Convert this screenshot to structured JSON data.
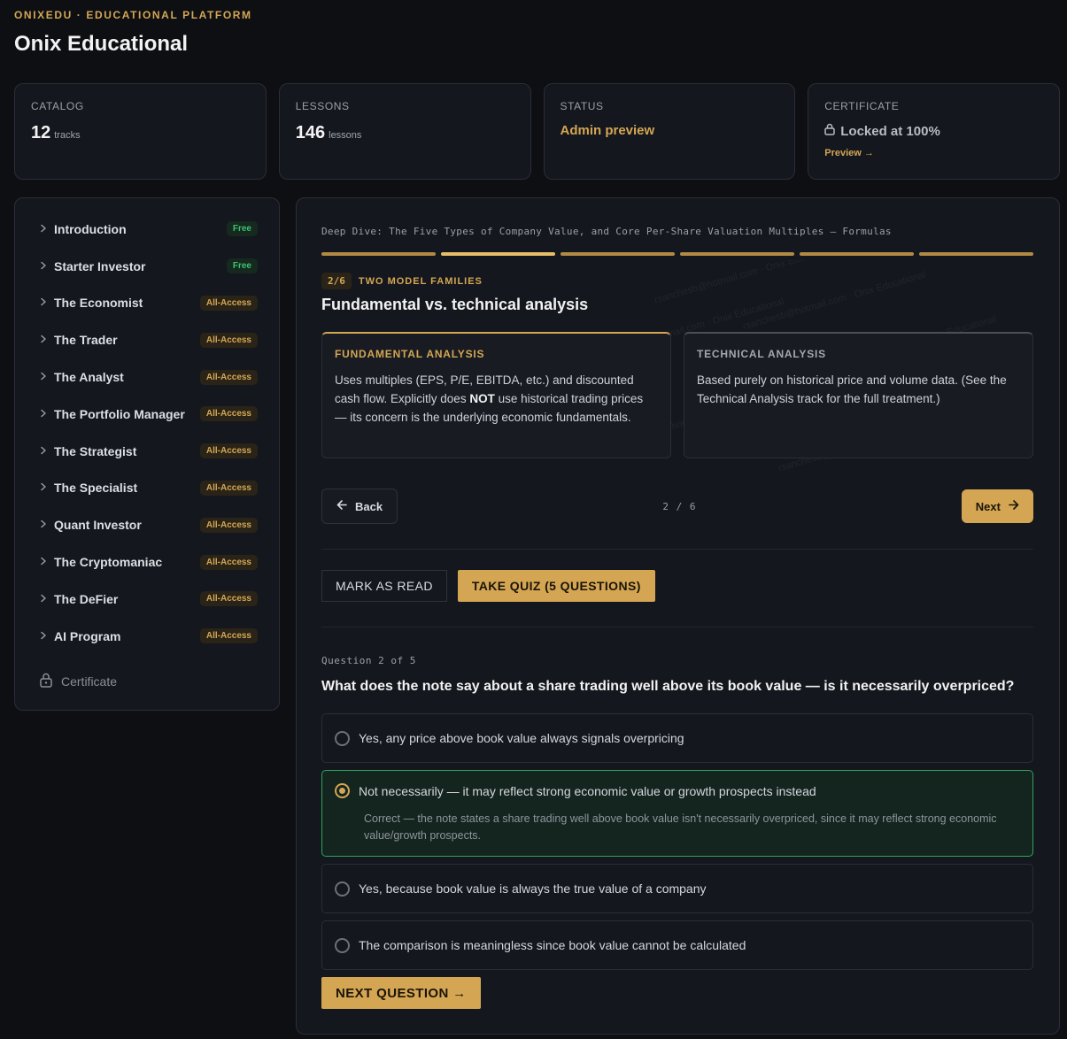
{
  "brand": {
    "kicker": "ONIXEDU · EDUCATIONAL PLATFORM",
    "title": "Onix Educational"
  },
  "stats": {
    "catalog": {
      "label": "CATALOG",
      "value": "12",
      "unit": "tracks"
    },
    "lessons": {
      "label": "LESSONS",
      "value": "146",
      "unit": "lessons"
    },
    "status": {
      "label": "STATUS",
      "value": "Admin preview"
    },
    "certificate": {
      "label": "CERTIFICATE",
      "value": "Locked at 100%",
      "link": "Preview →"
    }
  },
  "sidebar": {
    "items": [
      {
        "label": "Introduction",
        "badge": "Free"
      },
      {
        "label": "Starter Investor",
        "badge": "Free"
      },
      {
        "label": "The Economist",
        "badge": "All-Access"
      },
      {
        "label": "The Trader",
        "badge": "All-Access"
      },
      {
        "label": "The Analyst",
        "badge": "All-Access"
      },
      {
        "label": "The Portfolio Manager",
        "badge": "All-Access"
      },
      {
        "label": "The Strategist",
        "badge": "All-Access"
      },
      {
        "label": "The Specialist",
        "badge": "All-Access"
      },
      {
        "label": "Quant Investor",
        "badge": "All-Access"
      },
      {
        "label": "The Cryptomaniac",
        "badge": "All-Access"
      },
      {
        "label": "The DeFier",
        "badge": "All-Access"
      },
      {
        "label": "AI Program",
        "badge": "All-Access"
      }
    ],
    "certificate_label": "Certificate"
  },
  "lesson": {
    "title": "Deep Dive: The Five Types of Company Value, and Core Per-Share Valuation Multiples — Formulas",
    "total_slides": 6,
    "current_slide": 2,
    "step_chip": "2/6",
    "step_kicker": "TWO MODEL FAMILIES",
    "slide_title": "Fundamental vs. technical analysis",
    "watermark": "rsanchesb@hotmail.com · Onix Educational",
    "cards": {
      "fundamental": {
        "kicker": "FUNDAMENTAL ANALYSIS",
        "body_pre": "Uses multiples (EPS, P/E, EBITDA, etc.) and discounted cash flow. Explicitly does ",
        "body_bold": "NOT",
        "body_post": " use historical trading prices — its concern is the underlying economic fundamentals."
      },
      "technical": {
        "kicker": "TECHNICAL ANALYSIS",
        "body": "Based purely on historical price and volume data. (See the Technical Analysis track for the full treatment.)"
      }
    },
    "back_label": "Back",
    "page_indicator": "2 / 6",
    "next_label": "Next",
    "mark_read_label": "MARK AS READ",
    "take_quiz_label": "TAKE QUIZ (5 QUESTIONS)"
  },
  "quiz": {
    "counter": "Question 2 of 5",
    "question": "What does the note say about a share trading well above its book value — is it necessarily overpriced?",
    "options": [
      {
        "label": "Yes, any price above book value always signals overpricing"
      },
      {
        "label": "Not necessarily — it may reflect strong economic value or growth prospects instead",
        "feedback": "Correct — the note states a share trading well above book value isn't necessarily overpriced, since it may reflect strong economic value/growth prospects."
      },
      {
        "label": "Yes, because book value is always the true value of a company"
      },
      {
        "label": "The comparison is meaningless since book value cannot be calculated"
      }
    ],
    "selected_index": 1,
    "next_question_label": "NEXT QUESTION →"
  },
  "colors": {
    "accent": "#d4a654",
    "success": "#2fa35f",
    "background": "#0d0f13",
    "surface": "#14171d"
  },
  "icons": {
    "nav": "chevron-right-icon",
    "lock": "lock-icon",
    "back": "arrow-left-icon",
    "next": "arrow-right-icon"
  }
}
